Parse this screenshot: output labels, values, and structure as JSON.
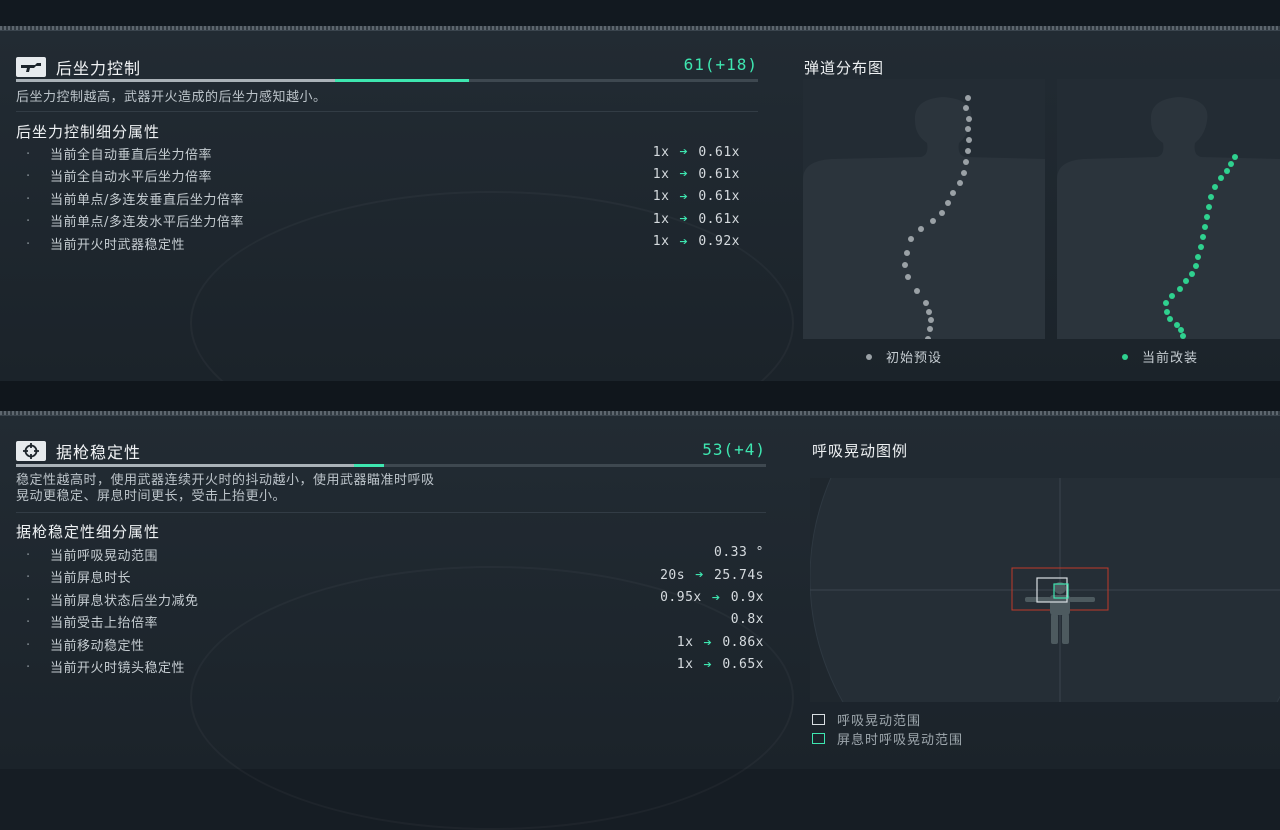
{
  "recoil": {
    "title": "后坐力控制",
    "icon": "rifle-icon",
    "score": "61(+18)",
    "base_fraction": 0.61,
    "gain_fraction": 0.18,
    "description": "后坐力控制越高，武器开火造成的后坐力感知越小。",
    "subtitle": "后坐力控制细分属性",
    "stats": [
      {
        "label": "当前全自动垂直后坐力倍率",
        "from": "1x",
        "to": "0.61x"
      },
      {
        "label": "当前全自动水平后坐力倍率",
        "from": "1x",
        "to": "0.61x"
      },
      {
        "label": "当前单点/多连发垂直后坐力倍率",
        "from": "1x",
        "to": "0.61x"
      },
      {
        "label": "当前单点/多连发水平后坐力倍率",
        "from": "1x",
        "to": "0.61x"
      },
      {
        "label": "当前开火时武器稳定性",
        "from": "1x",
        "to": "0.92x"
      }
    ],
    "pattern_title": "弹道分布图",
    "legend_default": "初始预设",
    "legend_current": "当前改装",
    "color_default": "#9aa1a6",
    "color_current": "#2fd18f"
  },
  "stability": {
    "title": "据枪稳定性",
    "icon": "crosshair-icon",
    "score": "53(+4)",
    "base_fraction": 0.49,
    "gain_fraction": 0.04,
    "description_line1": "稳定性越高时，使用武器连续开火时的抖动越小，使用武器瞄准时呼吸",
    "description_line2": "晃动更稳定、屏息时间更长，受击上抬更小。",
    "subtitle": "据枪稳定性细分属性",
    "stats": [
      {
        "label": "当前呼吸晃动范围",
        "from": "",
        "to": "0.33 °"
      },
      {
        "label": "当前屏息时长",
        "from": "20s",
        "to": "25.74s"
      },
      {
        "label": "当前屏息状态后坐力减免",
        "from": "0.95x",
        "to": "0.9x"
      },
      {
        "label": "当前受击上抬倍率",
        "from": "",
        "to": "0.8x"
      },
      {
        "label": "当前移动稳定性",
        "from": "1x",
        "to": "0.86x"
      },
      {
        "label": "当前开火时镜头稳定性",
        "from": "1x",
        "to": "0.65x"
      }
    ],
    "sway_title": "呼吸晃动图例",
    "legend_sway": "呼吸晃动范围",
    "legend_hold": "屏息时呼吸晃动范围",
    "color_sway": "#d9dee2",
    "color_hold": "#3ee6b0",
    "color_target": "#c0392b"
  },
  "accent": "#3ee6b0"
}
